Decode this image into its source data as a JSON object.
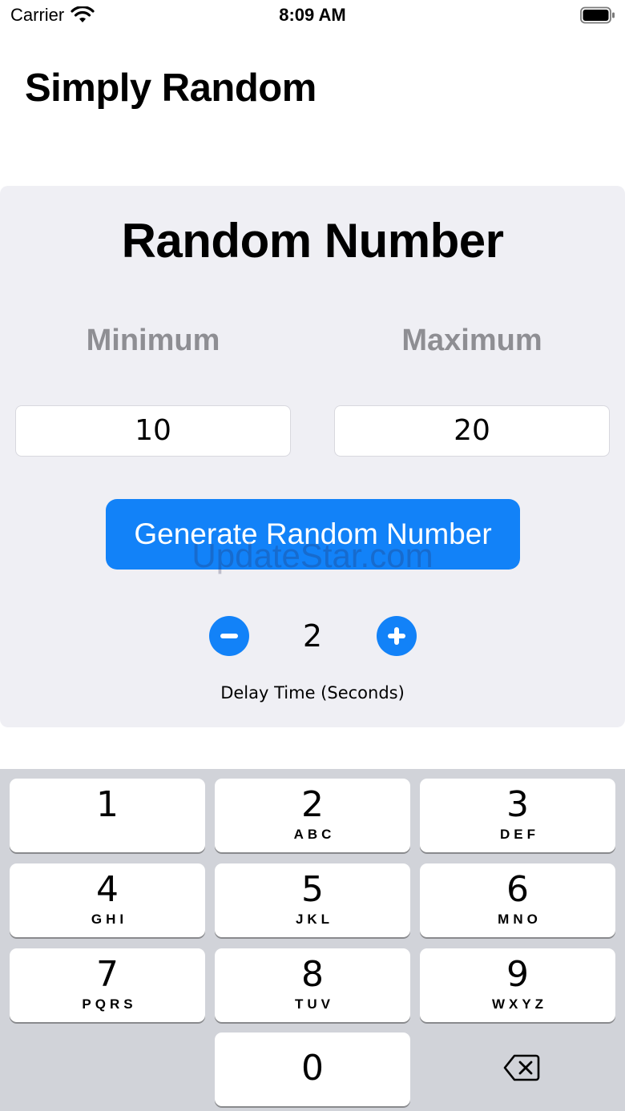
{
  "status_bar": {
    "carrier": "Carrier",
    "time": "8:09 AM",
    "wifi_icon": "wifi-icon",
    "battery_icon": "battery-icon"
  },
  "app_title": "Simply Random",
  "card": {
    "title": "Random Number",
    "minimum_label": "Minimum",
    "maximum_label": "Maximum",
    "minimum_value": "10",
    "maximum_value": "20",
    "generate_label": "Generate Random Number",
    "delay_value": "2",
    "delay_label": "Delay Time (Seconds)",
    "minus_icon": "minus-circle-icon",
    "plus_icon": "plus-circle-icon"
  },
  "watermark": "UpdateStar.com",
  "keyboard": {
    "keys": [
      {
        "digit": "1",
        "letters": ""
      },
      {
        "digit": "2",
        "letters": "ABC"
      },
      {
        "digit": "3",
        "letters": "DEF"
      },
      {
        "digit": "4",
        "letters": "GHI"
      },
      {
        "digit": "5",
        "letters": "JKL"
      },
      {
        "digit": "6",
        "letters": "MNO"
      },
      {
        "digit": "7",
        "letters": "PQRS"
      },
      {
        "digit": "8",
        "letters": "TUV"
      },
      {
        "digit": "9",
        "letters": "WXYZ"
      },
      {
        "digit": "0",
        "letters": ""
      }
    ],
    "delete_icon": "backspace-icon"
  },
  "colors": {
    "accent": "#1282f8",
    "card_bg": "#efeff4",
    "label_gray": "#8e8e93",
    "keyboard_bg": "#d1d3d9"
  }
}
